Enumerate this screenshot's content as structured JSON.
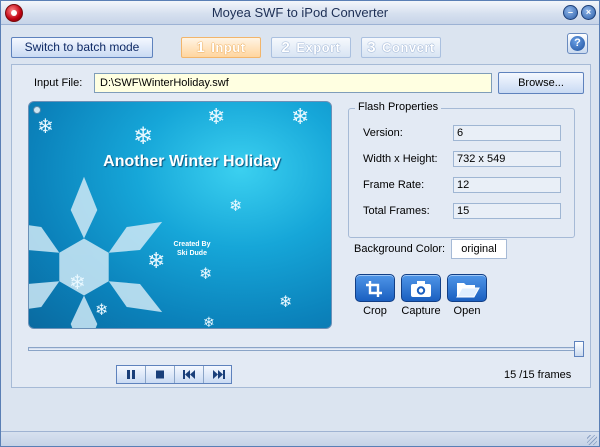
{
  "window": {
    "title": "Moyea SWF to iPod Converter",
    "minimize_glyph": "–",
    "close_glyph": "×"
  },
  "toolbar": {
    "batch_label": "Switch to batch mode",
    "steps": [
      {
        "num": "1",
        "label": "Input",
        "active": true
      },
      {
        "num": "2",
        "label": "Export",
        "active": false
      },
      {
        "num": "3",
        "label": "Convert",
        "active": false
      }
    ],
    "help_glyph": "?"
  },
  "input": {
    "label": "Input File:",
    "value": "D:\\SWF\\WinterHoliday.swf",
    "browse_label": "Browse..."
  },
  "preview": {
    "title": "Another Winter Holiday",
    "credit_line1": "Created By",
    "credit_line2": "Ski Dude"
  },
  "flash_properties": {
    "title": "Flash Properties",
    "rows": [
      {
        "label": "Version:",
        "value": "6"
      },
      {
        "label": "Width x Height:",
        "value": "732 x 549"
      },
      {
        "label": "Frame Rate:",
        "value": "12"
      },
      {
        "label": "Total Frames:",
        "value": "15"
      }
    ]
  },
  "background": {
    "label": "Background Color:",
    "value": "original"
  },
  "tools": [
    {
      "label": "Crop",
      "icon": "crop-icon"
    },
    {
      "label": "Capture",
      "icon": "camera-icon"
    },
    {
      "label": "Open",
      "icon": "folder-open-icon"
    }
  ],
  "playback": {
    "position_fraction": 1.0,
    "frames_text": "15 /15 frames"
  },
  "colors": {
    "accent": "#1a5fc0",
    "title_text": "#1d2f55",
    "active_step": "#ffd59e",
    "preview_bg": "#16a6d8"
  }
}
